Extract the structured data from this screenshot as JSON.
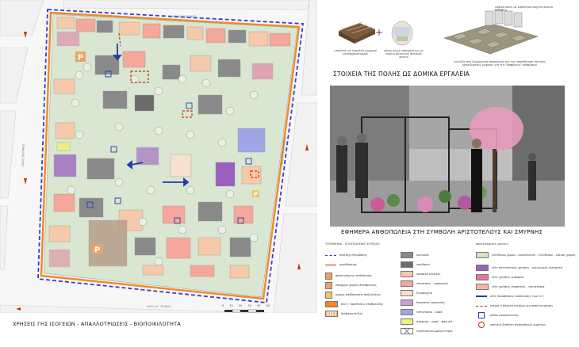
{
  "map": {
    "street_labels": [
      "ΟΔΟΣ ΧΑΛΚΙΔΩΝΟΣ",
      "ΟΔΟΣ ΑΓ. ΣΟΦΙΑΣ",
      "ΟΔΟΣ ΣΜΥΡΝΗΣ",
      "ΟΔΟΣ ΑΡΙΣΤΟΤΕΛΟΥΣ"
    ],
    "parking_letter": "P",
    "scale_ticks": [
      "0",
      "10",
      "20",
      "30",
      "40",
      "50"
    ]
  },
  "map_title": "ΧΡΗΣΕΙΣ ΓΗΣ ΙΣΟΓΕΙΩΝ - ΑΠΑΛΛΟΤΡΙΩΣΕΙΣ - ΒΙΟΠΟΙΚΙΛΟΤΗΤΑ",
  "urban_elements": {
    "caption1": "η παλέτα ως εργαλείο χωρικού μετασχηματισμού",
    "caption2": "σάκοι χώμα υπαρχόντων ως δοχεία φύτευσης αστικών φυτών",
    "caption3": "κυβικό κουτί με καθιστικά αρχιτεκτονικά στοιχεία",
    "caption4": "ευελιξία στη δημιουργία επιφανειών για την τοποθέτηση σκεύους καταλύματος χωρικής για την \"ασφάλεια\" ανθρώπων",
    "title": "ΣΤΟΙΧΕΙΑ ΤΗΣ ΠΟΛΗΣ ΩΣ ΔΟΜΙΚΑ ΕΡΓΑΛΕΙΑ",
    "plus": "+"
  },
  "photo_title": "ΕΦΗΜΕΡΑ ΑΝΘΟΠΩΛΕΙΑ ΣΤΗ ΣΥΜΒΟΛΗ ΑΡΙΣΤΟΤΕΛΟΥΣ ΚΑΙ ΣΜΥΡΝΗΣ",
  "legend": {
    "title_col1": "ΥΠΟΜΝΗΜΑ - ΠΟΛΕΟΔΟΜΙΚΟ ΕΠΙΠΕΔΟ",
    "title_col3": "προτεινόμενες χρήσεις",
    "col1": [
      {
        "label": "περιοχή επέμβασης",
        "color": "#ffffff",
        "line": "#3333cc"
      },
      {
        "label": "μονόδρομος",
        "color": "#ffffff",
        "line": "#cc3300"
      },
      {
        "label": "προτεινόμενη στάθμευση",
        "color": "#e9a565",
        "line": ""
      },
      {
        "label": "υπάρχων χώρος στάθμευσης",
        "color": "#e9a565",
        "line": ""
      },
      {
        "label": "χώρος στάθμευσης ποδηλάτων",
        "color": "#f4c26b",
        "line": ""
      },
      {
        "label": "θύλ.+ προθέσεις στάθμευσης",
        "color": "#f08a24",
        "line": ""
      },
      {
        "label": "διάβαση πεζών",
        "color": "#f2b58a",
        "line": ""
      }
    ],
    "col2": [
      {
        "label": "κατοικία",
        "color": "#8a8a8a"
      },
      {
        "label": "υπαίθριες",
        "color": "#6b6b6b"
      },
      {
        "label": "γραφεία κλινικές",
        "color": "#f6c9a8"
      },
      {
        "label": "υπηρεσίες - εμπορικές",
        "color": "#f4a79a"
      },
      {
        "label": "ξενοδοχεία",
        "color": "#f8e0cf"
      },
      {
        "label": "θεραπεία υπηρεσίες",
        "color": "#c79fd6"
      },
      {
        "label": "εστιατόρια - καφέ",
        "color": "#9fa6e6"
      },
      {
        "label": "αναψυχή - καφέ - φαγητό",
        "color": "#eef07a"
      },
      {
        "label": "εγκαταλελειμμένο κτίριο",
        "color": "#ffffff"
      }
    ],
    "col3": [
      {
        "label": "ελεύθεροι χώροι - αναγέννηση - ελεύθερος - κοινός χώρος",
        "color": "#cfe3c5"
      },
      {
        "label": "νέες πολιτιστικές χρήσεις - κοινωνικές ιδρύματα",
        "color": "#9b5fc0"
      },
      {
        "label": "νέες χρήσεις εμπορίου",
        "color": "#e07a9a"
      },
      {
        "label": "νέες χρήσεις υπηρεσίες - εστιατόρια",
        "color": "#f5b6a5"
      },
      {
        "label": "νέες προσβάσεις ανάπλασης των Ο.Τ.",
        "color": "#1f3ca8"
      },
      {
        "label": "κτίρια ή σύνολα κτιρίων για απαλλοτρίωση",
        "color": "#cc3300"
      },
      {
        "label": "κάδοι ανακύκλωσης",
        "color": "#3333aa"
      },
      {
        "label": "υπόγεια διάθεση ανθρώπινων εμφύτων",
        "color": "#cc3300"
      }
    ]
  }
}
